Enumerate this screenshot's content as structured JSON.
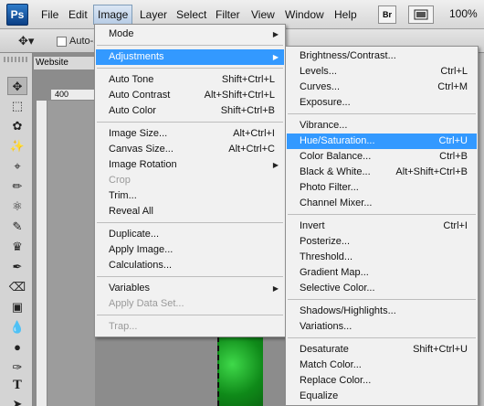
{
  "menubar": {
    "logo": "Ps",
    "items": [
      {
        "label": "File"
      },
      {
        "label": "Edit"
      },
      {
        "label": "Image"
      },
      {
        "label": "Layer"
      },
      {
        "label": "Select"
      },
      {
        "label": "Filter"
      },
      {
        "label": "View"
      },
      {
        "label": "Window"
      },
      {
        "label": "Help"
      }
    ],
    "bridge_label": "Br",
    "zoom": "100%"
  },
  "options": {
    "auto_select_label": "Auto-S"
  },
  "document": {
    "tab_label": "Website Design",
    "ruler_value": "400"
  },
  "image_menu": {
    "items": [
      {
        "label": "Mode",
        "shortcut": "",
        "submenu": true
      },
      {
        "label": "Adjustments",
        "shortcut": "",
        "submenu": true,
        "highlighted": true
      },
      {
        "label": "Auto Tone",
        "shortcut": "Shift+Ctrl+L"
      },
      {
        "label": "Auto Contrast",
        "shortcut": "Alt+Shift+Ctrl+L"
      },
      {
        "label": "Auto Color",
        "shortcut": "Shift+Ctrl+B"
      },
      {
        "label": "Image Size...",
        "shortcut": "Alt+Ctrl+I"
      },
      {
        "label": "Canvas Size...",
        "shortcut": "Alt+Ctrl+C"
      },
      {
        "label": "Image Rotation",
        "shortcut": "",
        "submenu": true
      },
      {
        "label": "Crop",
        "shortcut": "",
        "disabled": true
      },
      {
        "label": "Trim...",
        "shortcut": ""
      },
      {
        "label": "Reveal All",
        "shortcut": ""
      },
      {
        "label": "Duplicate...",
        "shortcut": ""
      },
      {
        "label": "Apply Image...",
        "shortcut": ""
      },
      {
        "label": "Calculations...",
        "shortcut": ""
      },
      {
        "label": "Variables",
        "shortcut": "",
        "submenu": true
      },
      {
        "label": "Apply Data Set...",
        "shortcut": "",
        "disabled": true
      },
      {
        "label": "Trap...",
        "shortcut": "",
        "disabled": true
      }
    ]
  },
  "adjustments_menu": {
    "items": [
      {
        "label": "Brightness/Contrast...",
        "shortcut": ""
      },
      {
        "label": "Levels...",
        "shortcut": "Ctrl+L"
      },
      {
        "label": "Curves...",
        "shortcut": "Ctrl+M"
      },
      {
        "label": "Exposure...",
        "shortcut": ""
      },
      {
        "label": "Vibrance...",
        "shortcut": ""
      },
      {
        "label": "Hue/Saturation...",
        "shortcut": "Ctrl+U",
        "highlighted": true
      },
      {
        "label": "Color Balance...",
        "shortcut": "Ctrl+B"
      },
      {
        "label": "Black & White...",
        "shortcut": "Alt+Shift+Ctrl+B"
      },
      {
        "label": "Photo Filter...",
        "shortcut": ""
      },
      {
        "label": "Channel Mixer...",
        "shortcut": ""
      },
      {
        "label": "Invert",
        "shortcut": "Ctrl+I"
      },
      {
        "label": "Posterize...",
        "shortcut": ""
      },
      {
        "label": "Threshold...",
        "shortcut": ""
      },
      {
        "label": "Gradient Map...",
        "shortcut": ""
      },
      {
        "label": "Selective Color...",
        "shortcut": ""
      },
      {
        "label": "Shadows/Highlights...",
        "shortcut": ""
      },
      {
        "label": "Variations...",
        "shortcut": ""
      },
      {
        "label": "Desaturate",
        "shortcut": "Shift+Ctrl+U"
      },
      {
        "label": "Match Color...",
        "shortcut": ""
      },
      {
        "label": "Replace Color...",
        "shortcut": ""
      },
      {
        "label": "Equalize",
        "shortcut": ""
      }
    ]
  },
  "colors": {
    "highlight": "#3399ff",
    "menu_bg": "#f1f1f1",
    "disabled": "#9a9a9a"
  }
}
